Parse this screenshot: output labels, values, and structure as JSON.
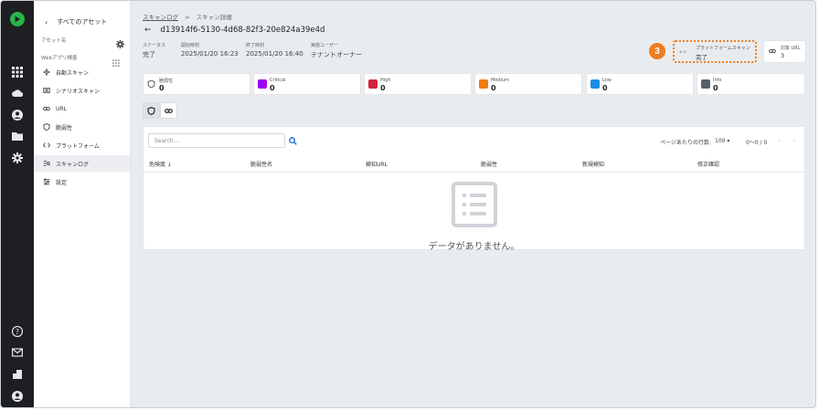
{
  "sidebar": {
    "back_label": "すべてのアセット",
    "asset_name_label": "アセット名",
    "section_label": "Webアプリ検査",
    "items": [
      {
        "label": "自動スキャン",
        "icon": "sparkle-icon"
      },
      {
        "label": "シナリオスキャン",
        "icon": "scenario-icon"
      },
      {
        "label": "URL",
        "icon": "link-icon"
      },
      {
        "label": "脆弱性",
        "icon": "shield-icon"
      },
      {
        "label": "プラットフォーム",
        "icon": "code-icon"
      },
      {
        "label": "スキャンログ",
        "icon": "scan-log-icon"
      },
      {
        "label": "設定",
        "icon": "settings-list-icon"
      }
    ]
  },
  "breadcrumb": {
    "link": "スキャンログ",
    "separator": ">",
    "current": "スキャン詳細"
  },
  "scan": {
    "id": "d13914f6-5130-4d68-82f3-20e824a39e4d",
    "meta": [
      {
        "label": "ステータス",
        "value": "完了"
      },
      {
        "label": "開始時刻",
        "value": "2025/01/20 16:23"
      },
      {
        "label": "終了時刻",
        "value": "2025/01/20 16:40"
      },
      {
        "label": "実施ユーザー",
        "value": "テナントオーナー"
      }
    ],
    "callout_number": "3",
    "platform_scan": {
      "label": "プラットフォームスキャン",
      "value": "完了"
    },
    "target_url": {
      "label": "対象 URL",
      "value": "3"
    }
  },
  "severity_cards": [
    {
      "label": "脆弱性",
      "value": "0",
      "color": ""
    },
    {
      "label": "Critical",
      "value": "0",
      "color": "#a100f2"
    },
    {
      "label": "High",
      "value": "0",
      "color": "#d3233a"
    },
    {
      "label": "Medium",
      "value": "0",
      "color": "#f07a0f"
    },
    {
      "label": "Low",
      "value": "0",
      "color": "#1a8fe3"
    },
    {
      "label": "Info",
      "value": "0",
      "color": "#595e66"
    }
  ],
  "table": {
    "search_placeholder": "Search…",
    "rows_per_page_label": "ページあたりの行数:",
    "rows_per_page_value": "100",
    "range": "0～0 / 0",
    "columns": [
      "危険度 ↓",
      "脆弱性名",
      "検知URL",
      "脆弱性",
      "新規検知",
      "修正確認"
    ],
    "empty_text": "データがありません。"
  }
}
